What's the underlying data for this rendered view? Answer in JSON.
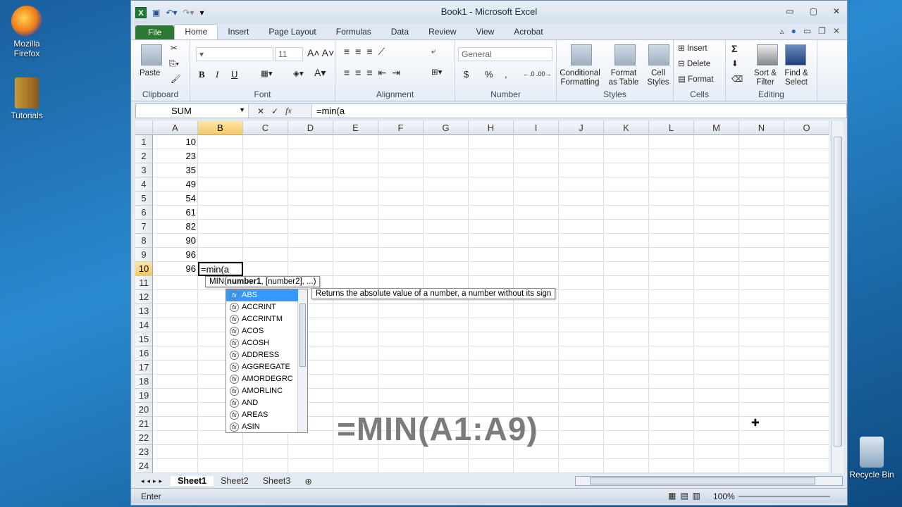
{
  "desktop": {
    "icons": [
      {
        "label": "Mozilla Firefox"
      },
      {
        "label": "Tutorials"
      },
      {
        "label": "Recycle Bin"
      }
    ]
  },
  "window": {
    "title": "Book1 - Microsoft Excel"
  },
  "tabs": [
    "File",
    "Home",
    "Insert",
    "Page Layout",
    "Formulas",
    "Data",
    "Review",
    "View",
    "Acrobat"
  ],
  "ribbon": {
    "clipboard": {
      "label": "Clipboard",
      "paste": "Paste"
    },
    "font": {
      "label": "Font",
      "size": "11",
      "bold": "B",
      "italic": "I",
      "underline": "U"
    },
    "alignment": {
      "label": "Alignment"
    },
    "number": {
      "label": "Number",
      "format": "General",
      "currency": "$",
      "percent": "%",
      "comma": ","
    },
    "styles": {
      "label": "Styles",
      "conditional": "Conditional Formatting",
      "table": "Format as Table",
      "cell": "Cell Styles"
    },
    "cells": {
      "label": "Cells",
      "insert": "Insert",
      "delete": "Delete",
      "format": "Format"
    },
    "editing": {
      "label": "Editing",
      "sum": "Σ",
      "sort": "Sort & Filter",
      "find": "Find & Select"
    }
  },
  "formula_bar": {
    "name_box": "SUM",
    "formula": "=min(a",
    "fx": "fx"
  },
  "columns": [
    "A",
    "B",
    "C",
    "D",
    "E",
    "F",
    "G",
    "H",
    "I",
    "J",
    "K",
    "L",
    "M",
    "N",
    "O"
  ],
  "rows": [
    "1",
    "2",
    "3",
    "4",
    "5",
    "6",
    "7",
    "8",
    "9",
    "10",
    "11",
    "12",
    "13",
    "14",
    "15",
    "16",
    "17",
    "18",
    "19",
    "20",
    "21",
    "22",
    "23",
    "24"
  ],
  "column_a": [
    "10",
    "23",
    "35",
    "49",
    "54",
    "61",
    "82",
    "90",
    "96",
    "96"
  ],
  "active_cell": {
    "ref": "B10",
    "value": "=min(a"
  },
  "signature_tip": {
    "fn": "MIN(",
    "arg1": "number1",
    "rest": ", [number2], ...)"
  },
  "autocomplete": [
    "ABS",
    "ACCRINT",
    "ACCRINTM",
    "ACOS",
    "ACOSH",
    "ADDRESS",
    "AGGREGATE",
    "AMORDEGRC",
    "AMORLINC",
    "AND",
    "AREAS",
    "ASIN"
  ],
  "description": "Returns the absolute value of a number, a number without its sign",
  "overlay_text": "=MIN(A1:A9)",
  "sheets": [
    "Sheet1",
    "Sheet2",
    "Sheet3"
  ],
  "status": {
    "mode": "Enter",
    "zoom": "100%"
  }
}
